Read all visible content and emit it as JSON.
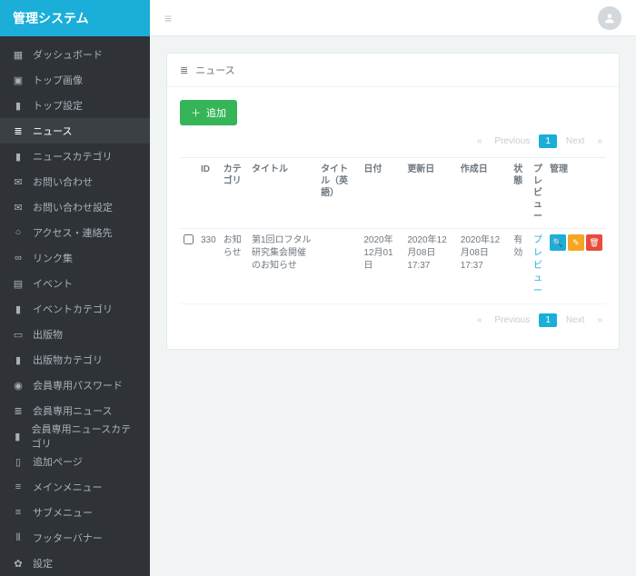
{
  "brand": "管理システム",
  "sidebar": {
    "items": [
      {
        "icon": "dashboard",
        "label": "ダッシュボード",
        "active": false
      },
      {
        "icon": "image",
        "label": "トップ画像",
        "active": false
      },
      {
        "icon": "folder",
        "label": "トップ設定",
        "active": false
      },
      {
        "icon": "list",
        "label": "ニュース",
        "active": true
      },
      {
        "icon": "folder",
        "label": "ニュースカテゴリ",
        "active": false
      },
      {
        "icon": "mail",
        "label": "お問い合わせ",
        "active": false
      },
      {
        "icon": "mail",
        "label": "お問い合わせ設定",
        "active": false
      },
      {
        "icon": "pin",
        "label": "アクセス・連絡先",
        "active": false
      },
      {
        "icon": "link",
        "label": "リンク集",
        "active": false
      },
      {
        "icon": "calendar",
        "label": "イベント",
        "active": false
      },
      {
        "icon": "folder",
        "label": "イベントカテゴリ",
        "active": false
      },
      {
        "icon": "book",
        "label": "出版物",
        "active": false
      },
      {
        "icon": "folder",
        "label": "出版物カテゴリ",
        "active": false
      },
      {
        "icon": "lock",
        "label": "会員専用パスワード",
        "active": false
      },
      {
        "icon": "list",
        "label": "会員専用ニュース",
        "active": false
      },
      {
        "icon": "folder",
        "label": "会員専用ニュースカテゴリ",
        "active": false
      },
      {
        "icon": "file",
        "label": "追加ページ",
        "active": false
      },
      {
        "icon": "menu",
        "label": "メインメニュー",
        "active": false
      },
      {
        "icon": "menu",
        "label": "サブメニュー",
        "active": false
      },
      {
        "icon": "barcode",
        "label": "フッターバナー",
        "active": false
      },
      {
        "icon": "gear",
        "label": "設定",
        "active": false
      }
    ]
  },
  "panel": {
    "title": "ニュース",
    "add_button": "追加"
  },
  "pagination": {
    "first": "«",
    "prev": "Previous",
    "page": "1",
    "next": "Next",
    "last": "»"
  },
  "table": {
    "headers": [
      "ID",
      "カテゴリ",
      "タイトル",
      "タイトル（英語）",
      "日付",
      "更新日",
      "作成日",
      "状態",
      "プレビュー",
      "管理"
    ],
    "rows": [
      {
        "id": "330",
        "category": "お知らせ",
        "title": "第1回ロフタル研究集会開催のお知らせ",
        "title_en": "",
        "date": "2020年12月01日",
        "updated_at": "2020年12月08日 17:37",
        "created_at": "2020年12月08日 17:37",
        "status": "有効",
        "preview": "プレビュー"
      }
    ]
  },
  "icons": {
    "dashboard": "▦",
    "image": "▣",
    "folder": "▮",
    "list": "≣",
    "mail": "✉",
    "pin": "○",
    "link": "∞",
    "calendar": "▤",
    "book": "▭",
    "lock": "◉",
    "file": "▯",
    "menu": "≡",
    "barcode": "⦀",
    "gear": "✿",
    "plus": "＋",
    "search": "🔍",
    "pencil": "✎",
    "trash": "🗑"
  }
}
